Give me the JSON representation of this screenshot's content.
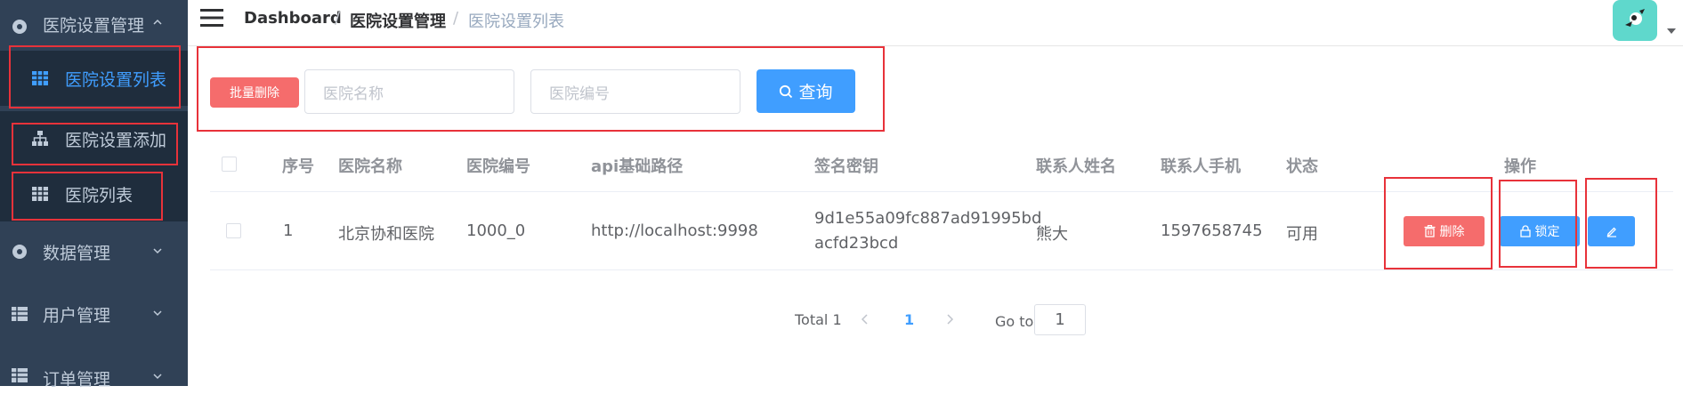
{
  "sidebar": {
    "items": [
      {
        "label": "医院设置管理"
      },
      {
        "label": "医院设置列表"
      },
      {
        "label": "医院设置添加"
      },
      {
        "label": "医院列表"
      },
      {
        "label": "数据管理"
      },
      {
        "label": "用户管理"
      },
      {
        "label": "订单管理"
      }
    ]
  },
  "breadcrumb": {
    "items": [
      "Dashboard",
      "医院设置管理",
      "医院设置列表"
    ],
    "separator": "/"
  },
  "toolbar": {
    "batch_delete_label": "批量删除",
    "hospital_name_placeholder": "医院名称",
    "hospital_code_placeholder": "医院编号",
    "query_label": "查询"
  },
  "table": {
    "headers": [
      "序号",
      "医院名称",
      "医院编号",
      "api基础路径",
      "签名密钥",
      "联系人姓名",
      "联系人手机",
      "状态",
      "操作"
    ],
    "rows": [
      {
        "index": "1",
        "name": "北京协和医院",
        "code": "1000_0",
        "api": "http://localhost:9998",
        "key_line1": "9d1e55a09fc887ad91995bd",
        "key_line2": "acfd23bcd",
        "contact": "熊大",
        "phone": "1597658745",
        "status": "可用",
        "delete_label": "删除",
        "lock_label": "锁定"
      }
    ]
  },
  "pagination": {
    "total": "Total 1",
    "current_page": "1",
    "goto_label": "Go to",
    "goto_value": "1"
  },
  "colors": {
    "sidebar_bg": "#304156",
    "accent": "#409eff",
    "danger": "#f56c6c",
    "highlight_box": "#e8323a"
  }
}
